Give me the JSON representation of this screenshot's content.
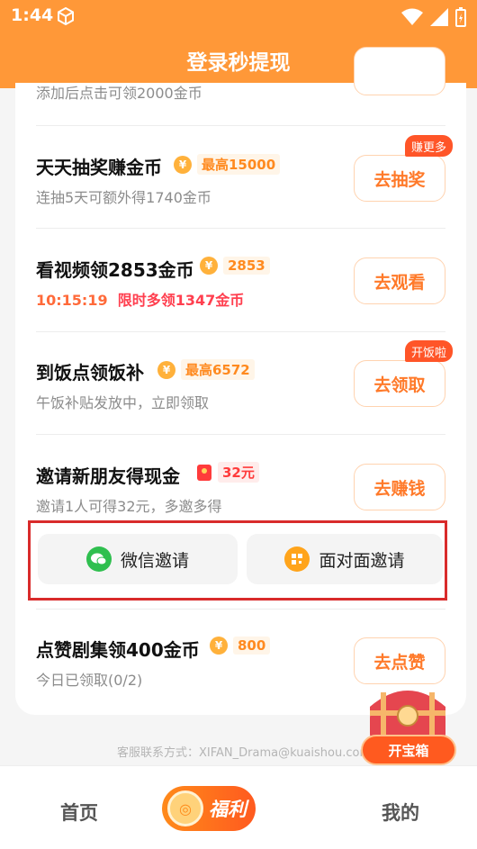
{
  "status_bar": {
    "time": "1:44"
  },
  "header": {
    "title": "登录秒提现"
  },
  "top_partial": {
    "subtitle": "添加后点击可领2000金币"
  },
  "tasks": [
    {
      "title": "天天抽奖赚金币",
      "badge": "最高15000",
      "sub": "连抽5天可额外得1740金币",
      "button": "去抽奖",
      "tag": "赚更多"
    },
    {
      "title": "看视频领2853金币",
      "badge": "2853",
      "sub_time": "10:15:19",
      "sub": "限时多领1347金币",
      "button": "去观看"
    },
    {
      "title": "到饭点领饭补",
      "badge": "最高6572",
      "sub": "午饭补贴发放中，立即领取",
      "button": "去领取",
      "tag": "开饭啦"
    },
    {
      "title": "邀请新朋友得现金",
      "badge": "32元",
      "sub": "邀请1人可得32元，多邀多得",
      "button": "去赚钱"
    },
    {
      "title": "点赞剧集领400金币",
      "badge": "800",
      "sub": "今日已领取(0/2)",
      "button": "去点赞"
    }
  ],
  "invite": {
    "wechat": "微信邀请",
    "face": "面对面邀请"
  },
  "contact": "客服联系方式：XIFAN_Drama@kuaishou.com",
  "treasure": {
    "button": "开宝箱"
  },
  "nav": {
    "home": "首页",
    "fuli": "福利",
    "mine": "我的"
  },
  "colors": {
    "header": "#ff9838",
    "accent": "#ff7a2a",
    "highlight": "#d92b2b"
  }
}
